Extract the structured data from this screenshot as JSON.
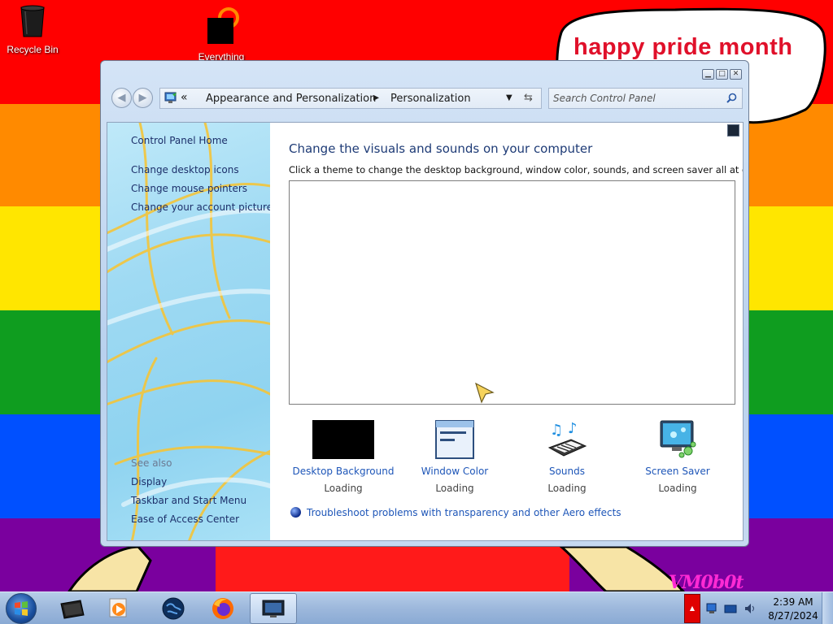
{
  "desktop": {
    "icons": [
      {
        "label": "Recycle Bin",
        "icon": "recycle-bin-icon"
      },
      {
        "label": "Everything",
        "icon": "everything-icon"
      }
    ],
    "speech_bubble_text": "happy pride month",
    "signature_text": "VM0b0t",
    "stripe_colors": [
      "#ff0000",
      "#ff8a00",
      "#ffe600",
      "#0f9d1f",
      "#0050ff",
      "#7a009e"
    ]
  },
  "window": {
    "caption_buttons": [
      "minimize",
      "maximize",
      "close"
    ],
    "address": {
      "overflow": "«",
      "crumbs": [
        "Appearance and Personalization",
        "Personalization"
      ],
      "separator": "▸"
    },
    "search_placeholder": "Search Control Panel",
    "left_pane": {
      "home": "Control Panel Home",
      "tasks": [
        "Change desktop icons",
        "Change mouse pointers",
        "Change your account picture"
      ],
      "see_also_heading": "See also",
      "see_also": [
        "Display",
        "Taskbar and Start Menu",
        "Ease of Access Center"
      ]
    },
    "main": {
      "title": "Change the visuals and sounds on your computer",
      "description": "Click a theme to change the desktop background, window color, sounds, and screen saver all at once.",
      "settings": [
        {
          "name": "Desktop Background",
          "status": "Loading",
          "icon": "desktop-background-icon"
        },
        {
          "name": "Window Color",
          "status": "Loading",
          "icon": "window-color-icon"
        },
        {
          "name": "Sounds",
          "status": "Loading",
          "icon": "sounds-icon"
        },
        {
          "name": "Screen Saver",
          "status": "Loading",
          "icon": "screen-saver-icon"
        }
      ],
      "troubleshoot_link": "Troubleshoot problems with transparency and other Aero effects"
    }
  },
  "taskbar": {
    "pinned": [
      "file-explorer-icon",
      "media-player-icon",
      "globe-icon",
      "firefox-icon",
      "personalization-window-icon"
    ],
    "clock": {
      "time": "2:39 AM",
      "date": "8/27/2024"
    },
    "accent": "#e00000"
  }
}
